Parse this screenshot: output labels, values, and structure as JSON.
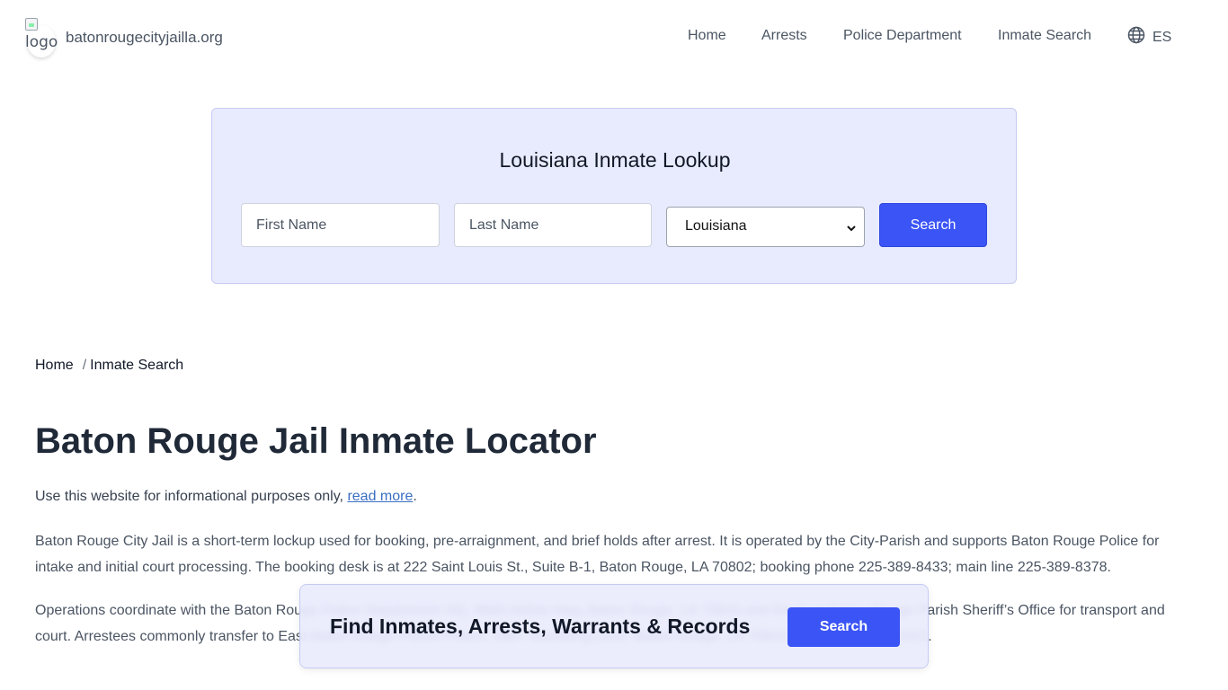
{
  "header": {
    "logo_alt": "logo",
    "site_name": "batonrougecityjailla.org",
    "nav": [
      "Home",
      "Arrests",
      "Police Department",
      "Inmate Search"
    ],
    "language": "ES"
  },
  "lookup": {
    "title": "Louisiana Inmate Lookup",
    "first_name_placeholder": "First Name",
    "last_name_placeholder": "Last Name",
    "state_selected": "Louisiana",
    "search_label": "Search"
  },
  "breadcrumb": {
    "home": "Home",
    "separator": "/",
    "current": "Inmate Search"
  },
  "content": {
    "title": "Baton Rouge Jail Inmate Locator",
    "note_prefix": "Use this website for informational purposes only,",
    "note_link": "read more",
    "note_suffix": ".",
    "paragraph1": "Baton Rouge City Jail is a short-term lockup used for booking, pre-arraignment, and brief holds after arrest. It is operated by the City-Parish and supports Baton Rouge Police for intake and initial court processing. The booking desk is at 222 Saint Louis St., Suite B-1, Baton Rouge, LA 70802; booking phone 225-389-8433; main line 225-389-8378.",
    "paragraph2": "Operations coordinate with the Baton Rouge Police Department HQ, 9000 Airline Hwy, Baton Rouge, LA 70815 and the East Baton Rouge Parish Sheriff’s Office for transport and court. Arrestees commonly transfer to East Baton Rouge Parish Prison, 2867 Stumberg Lane, Baton Rouge, LA 70816; phone 225-355-3311."
  },
  "cta": {
    "text": "Find Inmates, Arrests, Warrants & Records",
    "button": "Search"
  },
  "colors": {
    "accent": "#3b54f5",
    "panel_bg": "#e8ebfd",
    "link": "#3b6fc4"
  },
  "icons": {
    "language": "globe-icon",
    "select": "chevron-down-icon",
    "logo": "broken-image-icon"
  }
}
